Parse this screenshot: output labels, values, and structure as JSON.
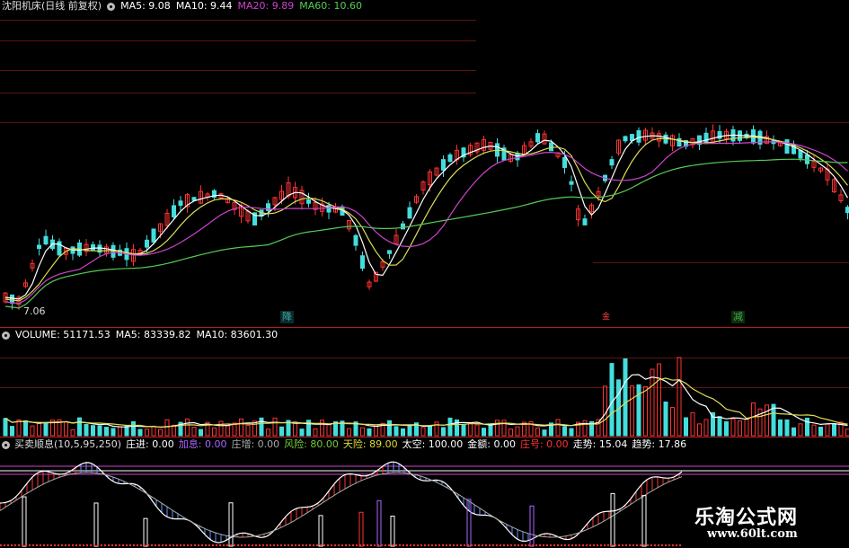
{
  "price_pane": {
    "title": "沈阳机床(日线 前复权)",
    "indicators": [
      {
        "label": "MA5: 9.08",
        "color": "#ffffff"
      },
      {
        "label": "MA10: 9.44",
        "color": "#ffffff"
      },
      {
        "label": "MA20: 9.89",
        "color": "#cc44cc"
      },
      {
        "label": "MA60: 10.60",
        "color": "#55cc55"
      }
    ],
    "low_label": "7.06",
    "markers": [
      {
        "text": "降",
        "color": "#44aaaa"
      },
      {
        "text": "金",
        "color": "#ff4444"
      },
      {
        "text": "减",
        "color": "#44aa44"
      }
    ]
  },
  "volume_pane": {
    "indicators": [
      {
        "label": "VOLUME: 51171.53",
        "color": "#ffffff"
      },
      {
        "label": "MA5: 83339.82",
        "color": "#ffffff"
      },
      {
        "label": "MA10: 83601.30",
        "color": "#ffffff"
      }
    ]
  },
  "indicator_pane": {
    "name": "买卖顺息(10,5,95,250)",
    "values": [
      {
        "label": "庄进: 0.00",
        "color": "#ffffff"
      },
      {
        "label": "加息: 0.00",
        "color": "#aa66ff"
      },
      {
        "label": "庄增: 0.00",
        "color": "#aaaaaa"
      },
      {
        "label": "风险: 80.00",
        "color": "#77cc33"
      },
      {
        "label": "天险: 89.00",
        "color": "#dddd33"
      },
      {
        "label": "太空: 100.00",
        "color": "#ffffff"
      },
      {
        "label": "金额: 0.00",
        "color": "#ffffff"
      },
      {
        "label": "庄号: 0.00",
        "color": "#ff3333"
      },
      {
        "label": "走势: 15.04",
        "color": "#ffffff"
      },
      {
        "label": "趋势: 17.86",
        "color": "#ffffff"
      }
    ]
  },
  "watermark": {
    "title": "乐淘公式网",
    "url": "www.60lt.com"
  },
  "colors": {
    "up": "#ff3333",
    "down": "#44dddd",
    "ma5": "#ffffff",
    "ma10": "#dddd55",
    "ma20": "#cc44cc",
    "ma60": "#55cc55",
    "separator": "#b21e1e"
  }
}
